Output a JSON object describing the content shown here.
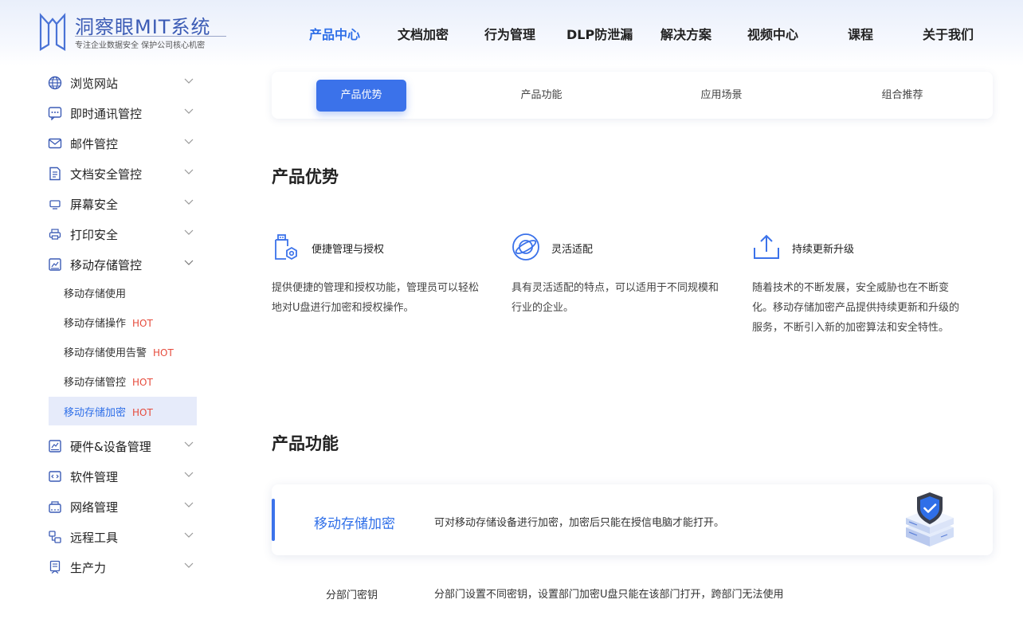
{
  "logo": {
    "title": "洞察眼MIT系统",
    "subtitle": "专注企业数据安全 保护公司核心机密"
  },
  "nav": [
    {
      "label": "产品中心",
      "active": true
    },
    {
      "label": "文档加密"
    },
    {
      "label": "行为管理"
    },
    {
      "label": "DLP防泄漏"
    },
    {
      "label": "解决方案"
    },
    {
      "label": "视频中心"
    },
    {
      "label": "课程"
    },
    {
      "label": "关于我们"
    }
  ],
  "sidebar": {
    "items": [
      {
        "label": "浏览网站",
        "icon": "globe-icon"
      },
      {
        "label": "即时通讯管控",
        "icon": "chat-icon"
      },
      {
        "label": "邮件管控",
        "icon": "mail-icon"
      },
      {
        "label": "文档安全管控",
        "icon": "document-icon"
      },
      {
        "label": "屏幕安全",
        "icon": "monitor-icon"
      },
      {
        "label": "打印安全",
        "icon": "printer-icon"
      },
      {
        "label": "移动存储管控",
        "icon": "storage-icon",
        "expanded": true
      },
      {
        "label": "硬件&设备管理",
        "icon": "hardware-icon"
      },
      {
        "label": "软件管理",
        "icon": "code-icon"
      },
      {
        "label": "网络管理",
        "icon": "network-icon"
      },
      {
        "label": "远程工具",
        "icon": "remote-icon"
      },
      {
        "label": "生产力",
        "icon": "productivity-icon"
      }
    ],
    "sub_items": [
      {
        "label": "移动存储使用",
        "hot": ""
      },
      {
        "label": "移动存储操作",
        "hot": "HOT"
      },
      {
        "label": "移动存储使用告警",
        "hot": "HOT"
      },
      {
        "label": "移动存储管控",
        "hot": "HOT"
      },
      {
        "label": "移动存储加密",
        "hot": "HOT",
        "active": true
      }
    ]
  },
  "tabs": [
    {
      "label": "产品优势",
      "active": true
    },
    {
      "label": "产品功能"
    },
    {
      "label": "应用场景"
    },
    {
      "label": "组合推荐"
    }
  ],
  "advantages": {
    "title": "产品优势",
    "items": [
      {
        "title": "便捷管理与授权",
        "icon": "usb-lock-icon",
        "desc": "提供便捷的管理和授权功能，管理员可以轻松地对U盘进行加密和授权操作。"
      },
      {
        "title": "灵活适配",
        "icon": "planet-icon",
        "desc": "具有灵活适配的特点，可以适用于不同规模和行业的企业。"
      },
      {
        "title": "持续更新升级",
        "icon": "upload-icon",
        "desc": "随着技术的不断发展，安全威胁也在不断变化。移动存储加密产品提供持续更新和升级的服务，不断引入新的加密算法和安全特性。"
      }
    ]
  },
  "functions": {
    "title": "产品功能",
    "card": {
      "name": "移动存储加密",
      "desc": "可对移动存储设备进行加密，加密后只能在授信电脑才能打开。"
    },
    "rows": [
      {
        "name": "分部门密钥",
        "desc": "分部门设置不同密钥，设置部门加密U盘只能在该部门打开，跨部门无法使用"
      }
    ]
  },
  "colors": {
    "accent": "#3b72ea",
    "hot": "#e64b3c",
    "active_bg": "#e6ebfa"
  }
}
